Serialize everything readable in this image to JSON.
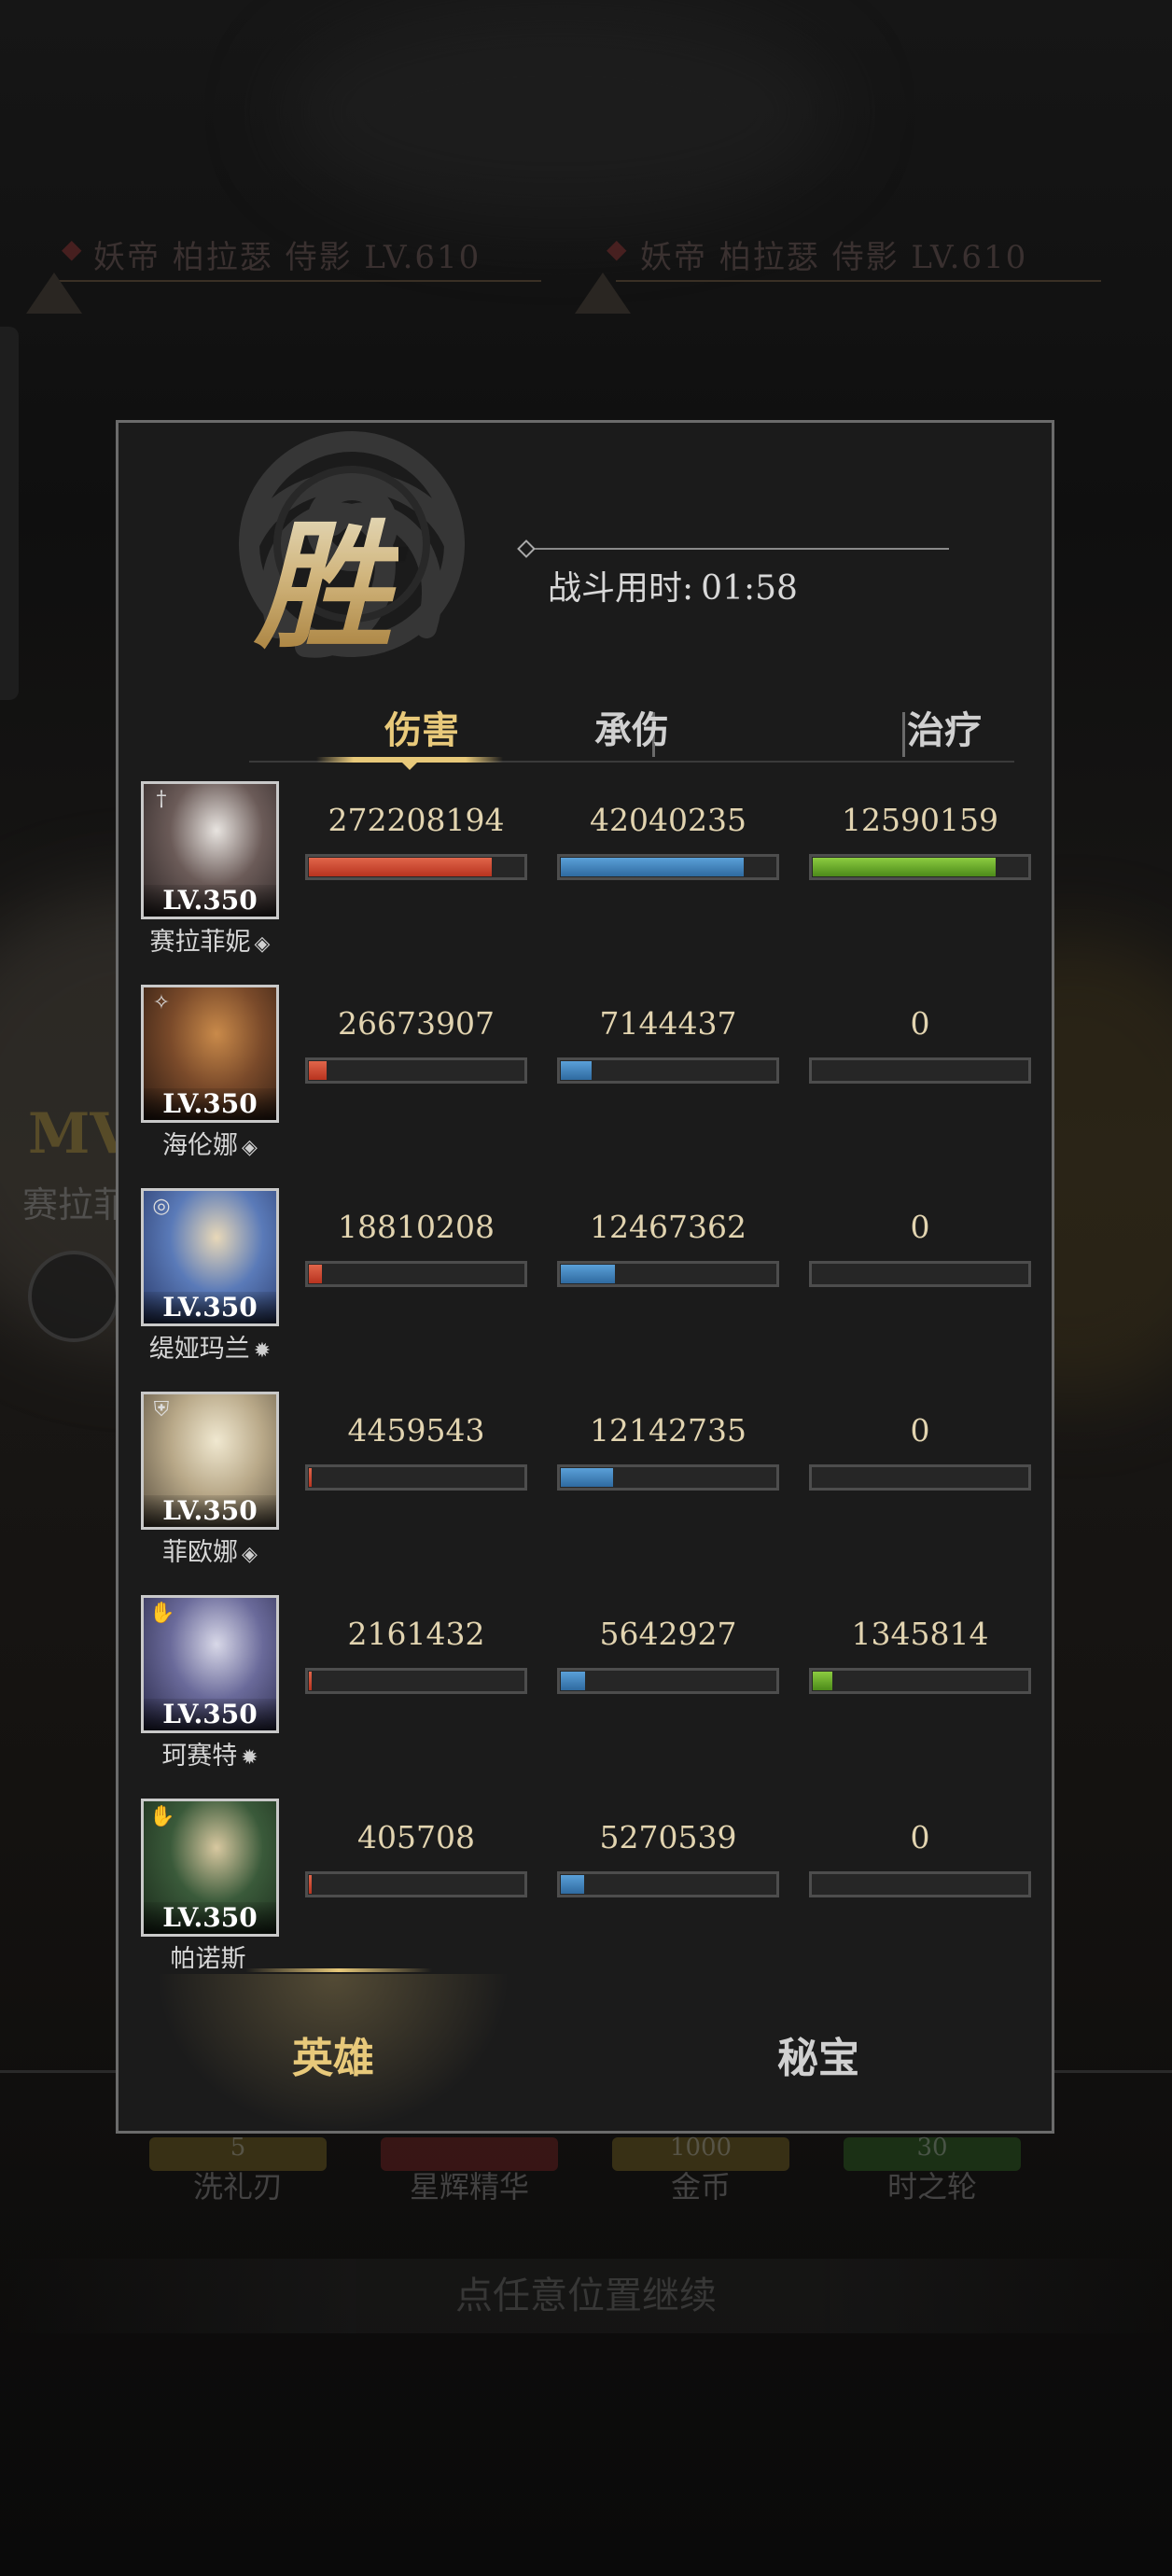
{
  "background": {
    "boss_labels": [
      "妖帝 柏拉瑟 侍影 LV.610",
      "妖帝 柏拉瑟 侍影 LV.610"
    ],
    "mvp_label": "MV",
    "mvp_hero": "赛拉菲",
    "rewards": [
      "洗礼刃",
      "星辉精华",
      "金币",
      "时之轮"
    ],
    "reward_counts": [
      "5",
      "",
      "1000",
      "30"
    ],
    "continue_text": "点任意位置继续"
  },
  "result": {
    "victory_glyph": "胜",
    "timer_label": "战斗用时:",
    "timer_value": "01:58"
  },
  "tabs": [
    {
      "label": "伤害",
      "active": true
    },
    {
      "label": "承伤",
      "active": false
    },
    {
      "label": "治疗",
      "active": false
    }
  ],
  "max": {
    "damage": 272208194,
    "taken": 42040235,
    "heal": 12590159
  },
  "heroes": [
    {
      "name": "赛拉菲妮",
      "element": "◈",
      "class_icon": "†",
      "level": "LV.350",
      "damage": "272208194",
      "taken": "42040235",
      "heal": "12590159",
      "art": [
        "#e8e4e0",
        "#6b5b58",
        "#2b2424"
      ]
    },
    {
      "name": "海伦娜",
      "element": "◈",
      "class_icon": "✧",
      "level": "LV.350",
      "damage": "26673907",
      "taken": "7144437",
      "heal": "0",
      "art": [
        "#c98a4a",
        "#7a4a2a",
        "#2a1a12"
      ]
    },
    {
      "name": "缇娅玛兰",
      "element": "✹",
      "class_icon": "◎",
      "level": "LV.350",
      "damage": "18810208",
      "taken": "12467362",
      "heal": "0",
      "art": [
        "#e8d8b8",
        "#5a7ab8",
        "#2a3a6a"
      ]
    },
    {
      "name": "菲欧娜",
      "element": "◈",
      "class_icon": "⛨",
      "level": "LV.350",
      "damage": "4459543",
      "taken": "12142735",
      "heal": "0",
      "art": [
        "#f0e8d0",
        "#b8a888",
        "#5a5040"
      ]
    },
    {
      "name": "珂赛特",
      "element": "✹",
      "class_icon": "✋",
      "level": "LV.350",
      "damage": "2161432",
      "taken": "5642927",
      "heal": "1345814",
      "art": [
        "#d8d8e8",
        "#6a6a9a",
        "#2a2a4a"
      ]
    },
    {
      "name": "帕诺斯",
      "element": "",
      "class_icon": "✋",
      "level": "LV.350",
      "damage": "405708",
      "taken": "5270539",
      "heal": "0",
      "art": [
        "#d8c8a0",
        "#3a5a3a",
        "#1a2a1a"
      ]
    }
  ],
  "bottom_tabs": [
    {
      "label": "英雄",
      "active": true
    },
    {
      "label": "秘宝",
      "active": false
    }
  ],
  "colors": {
    "accent_gold": "#e8c97a",
    "damage": "#c8432a",
    "taken": "#3d7fbf",
    "heal": "#6aae2a"
  }
}
